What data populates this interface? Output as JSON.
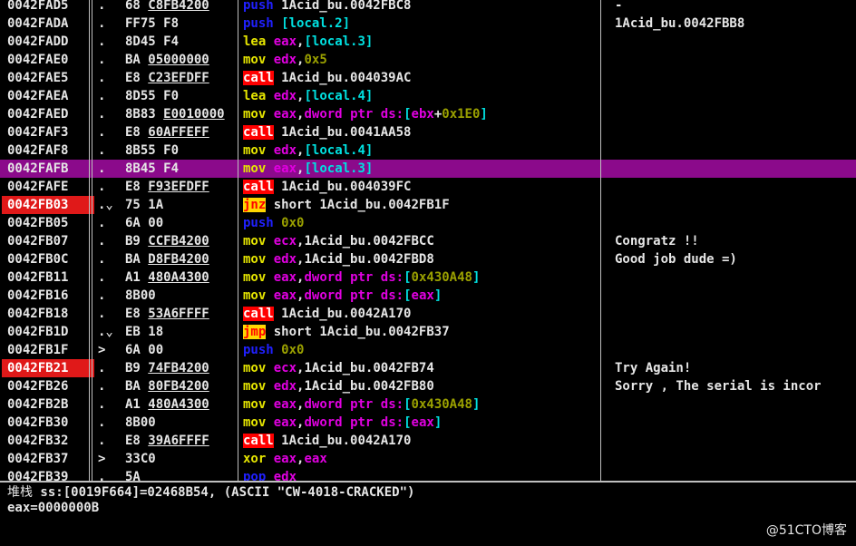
{
  "colors": {
    "background": "#000000",
    "text": "#e6e6e6",
    "selected_row": "#8b0a8b",
    "breakpoint": "#e01919",
    "call_jump_bg_call": "#ff0000",
    "call_jump_bg_jump": "#ffd700",
    "push_pop": "#2020ff",
    "mov_lea": "#e6e600",
    "register": "#e000e0",
    "bracket": "#00e0e0",
    "immediate": "#9aa000"
  },
  "cpu_rows": [
    {
      "addr": "0042FAD5",
      "mark": ".",
      "hex": "68 C8FB4200",
      "asm": "push 1Acid_bu.0042FBC8",
      "comment": "-"
    },
    {
      "addr": "0042FADA",
      "mark": ".",
      "hex": "FF75 F8",
      "asm": "push [local.2]",
      "comment": "1Acid_bu.0042FBB8"
    },
    {
      "addr": "0042FADD",
      "mark": ".",
      "hex": "8D45 F4",
      "asm": "lea eax,[local.3]",
      "comment": ""
    },
    {
      "addr": "0042FAE0",
      "mark": ".",
      "hex": "BA 05000000",
      "asm": "mov edx,0x5",
      "comment": ""
    },
    {
      "addr": "0042FAE5",
      "mark": ".",
      "hex": "E8 C23EFDFF",
      "asm": "call 1Acid_bu.004039AC",
      "comment": ""
    },
    {
      "addr": "0042FAEA",
      "mark": ".",
      "hex": "8D55 F0",
      "asm": "lea edx,[local.4]",
      "comment": ""
    },
    {
      "addr": "0042FAED",
      "mark": ".",
      "hex": "8B83 E0010000",
      "asm": "mov eax,dword ptr ds:[ebx+0x1E0]",
      "comment": ""
    },
    {
      "addr": "0042FAF3",
      "mark": ".",
      "hex": "E8 60AFFEFF",
      "asm": "call 1Acid_bu.0041AA58",
      "comment": ""
    },
    {
      "addr": "0042FAF8",
      "mark": ".",
      "hex": "8B55 F0",
      "asm": "mov edx,[local.4]",
      "comment": ""
    },
    {
      "addr": "0042FAFB",
      "mark": ".",
      "hex": "8B45 F4",
      "asm": "mov eax,[local.3]",
      "comment": "",
      "selected": true
    },
    {
      "addr": "0042FAFE",
      "mark": ".",
      "hex": "E8 F93EFDFF",
      "asm": "call 1Acid_bu.004039FC",
      "comment": ""
    },
    {
      "addr": "0042FB03",
      "mark": ".⌄",
      "hex": "75 1A",
      "asm": "jnz short 1Acid_bu.0042FB1F",
      "comment": "",
      "breakpoint": true
    },
    {
      "addr": "0042FB05",
      "mark": ".",
      "hex": "6A 00",
      "asm": "push 0x0",
      "comment": ""
    },
    {
      "addr": "0042FB07",
      "mark": ".",
      "hex": "B9 CCFB4200",
      "asm": "mov ecx,1Acid_bu.0042FBCC",
      "comment": "Congratz !!"
    },
    {
      "addr": "0042FB0C",
      "mark": ".",
      "hex": "BA D8FB4200",
      "asm": "mov edx,1Acid_bu.0042FBD8",
      "comment": "Good job dude =)"
    },
    {
      "addr": "0042FB11",
      "mark": ".",
      "hex": "A1 480A4300",
      "asm": "mov eax,dword ptr ds:[0x430A48]",
      "comment": ""
    },
    {
      "addr": "0042FB16",
      "mark": ".",
      "hex": "8B00",
      "asm": "mov eax,dword ptr ds:[eax]",
      "comment": ""
    },
    {
      "addr": "0042FB18",
      "mark": ".",
      "hex": "E8 53A6FFFF",
      "asm": "call 1Acid_bu.0042A170",
      "comment": ""
    },
    {
      "addr": "0042FB1D",
      "mark": ".⌄",
      "hex": "EB 18",
      "asm": "jmp short 1Acid_bu.0042FB37",
      "comment": ""
    },
    {
      "addr": "0042FB1F",
      "mark": ">",
      "hex": "6A 00",
      "asm": "push 0x0",
      "comment": ""
    },
    {
      "addr": "0042FB21",
      "mark": ".",
      "hex": "B9 74FB4200",
      "asm": "mov ecx,1Acid_bu.0042FB74",
      "comment": "Try Again!",
      "breakpoint": true
    },
    {
      "addr": "0042FB26",
      "mark": ".",
      "hex": "BA 80FB4200",
      "asm": "mov edx,1Acid_bu.0042FB80",
      "comment": "Sorry , The serial is incor"
    },
    {
      "addr": "0042FB2B",
      "mark": ".",
      "hex": "A1 480A4300",
      "asm": "mov eax,dword ptr ds:[0x430A48]",
      "comment": ""
    },
    {
      "addr": "0042FB30",
      "mark": ".",
      "hex": "8B00",
      "asm": "mov eax,dword ptr ds:[eax]",
      "comment": ""
    },
    {
      "addr": "0042FB32",
      "mark": ".",
      "hex": "E8 39A6FFFF",
      "asm": "call 1Acid_bu.0042A170",
      "comment": ""
    },
    {
      "addr": "0042FB37",
      "mark": ">",
      "hex": "33C0",
      "asm": "xor eax,eax",
      "comment": ""
    },
    {
      "addr": "0042FB39",
      "mark": ".",
      "hex": "5A",
      "asm": "pop edx",
      "comment": ""
    }
  ],
  "info_pane": {
    "stack_label": "堆栈",
    "stack_value": " ss:[0019F664]=02468B54, (ASCII \"CW-4018-CRACKED\")",
    "register_line": "eax=0000000B"
  },
  "watermark": "@51CTO博客"
}
